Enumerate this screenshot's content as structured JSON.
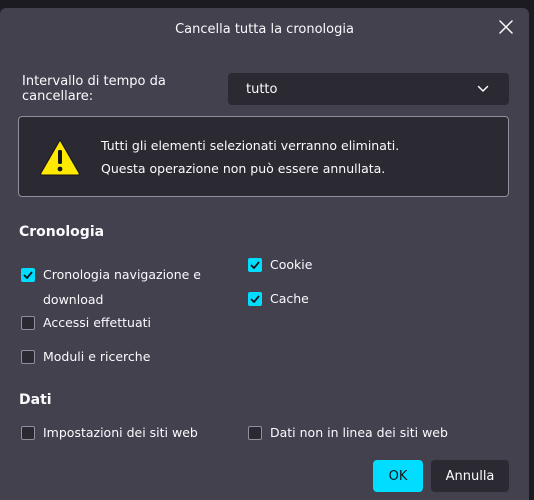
{
  "dialog": {
    "title": "Cancella tutta la cronologia"
  },
  "time_range": {
    "label": "Intervallo di tempo da cancellare:",
    "value": "tutto"
  },
  "warning": {
    "line1": "Tutti gli elementi selezionati verranno eliminati.",
    "line2": "Questa operazione non può essere annullata."
  },
  "history_section": {
    "title": "Cronologia",
    "items": [
      {
        "label": "Cronologia navigazione e download",
        "checked": true
      },
      {
        "label": "Accessi effettuati",
        "checked": false
      },
      {
        "label": "Moduli e ricerche",
        "checked": false
      },
      {
        "label": "Cookie",
        "checked": true
      },
      {
        "label": "Cache",
        "checked": true
      }
    ]
  },
  "data_section": {
    "title": "Dati",
    "items": [
      {
        "label": "Impostazioni dei siti web",
        "checked": false
      },
      {
        "label": "Dati non in linea dei siti web",
        "checked": false
      }
    ]
  },
  "buttons": {
    "ok": "OK",
    "cancel": "Annulla"
  },
  "colors": {
    "accent": "#00ddff",
    "dialog_bg": "#42414d",
    "field_bg": "#2b2a33"
  },
  "icons": {
    "close": "close-icon",
    "dropdown": "chevron-down-icon",
    "warning": "warning-icon",
    "check": "checkmark-icon"
  }
}
